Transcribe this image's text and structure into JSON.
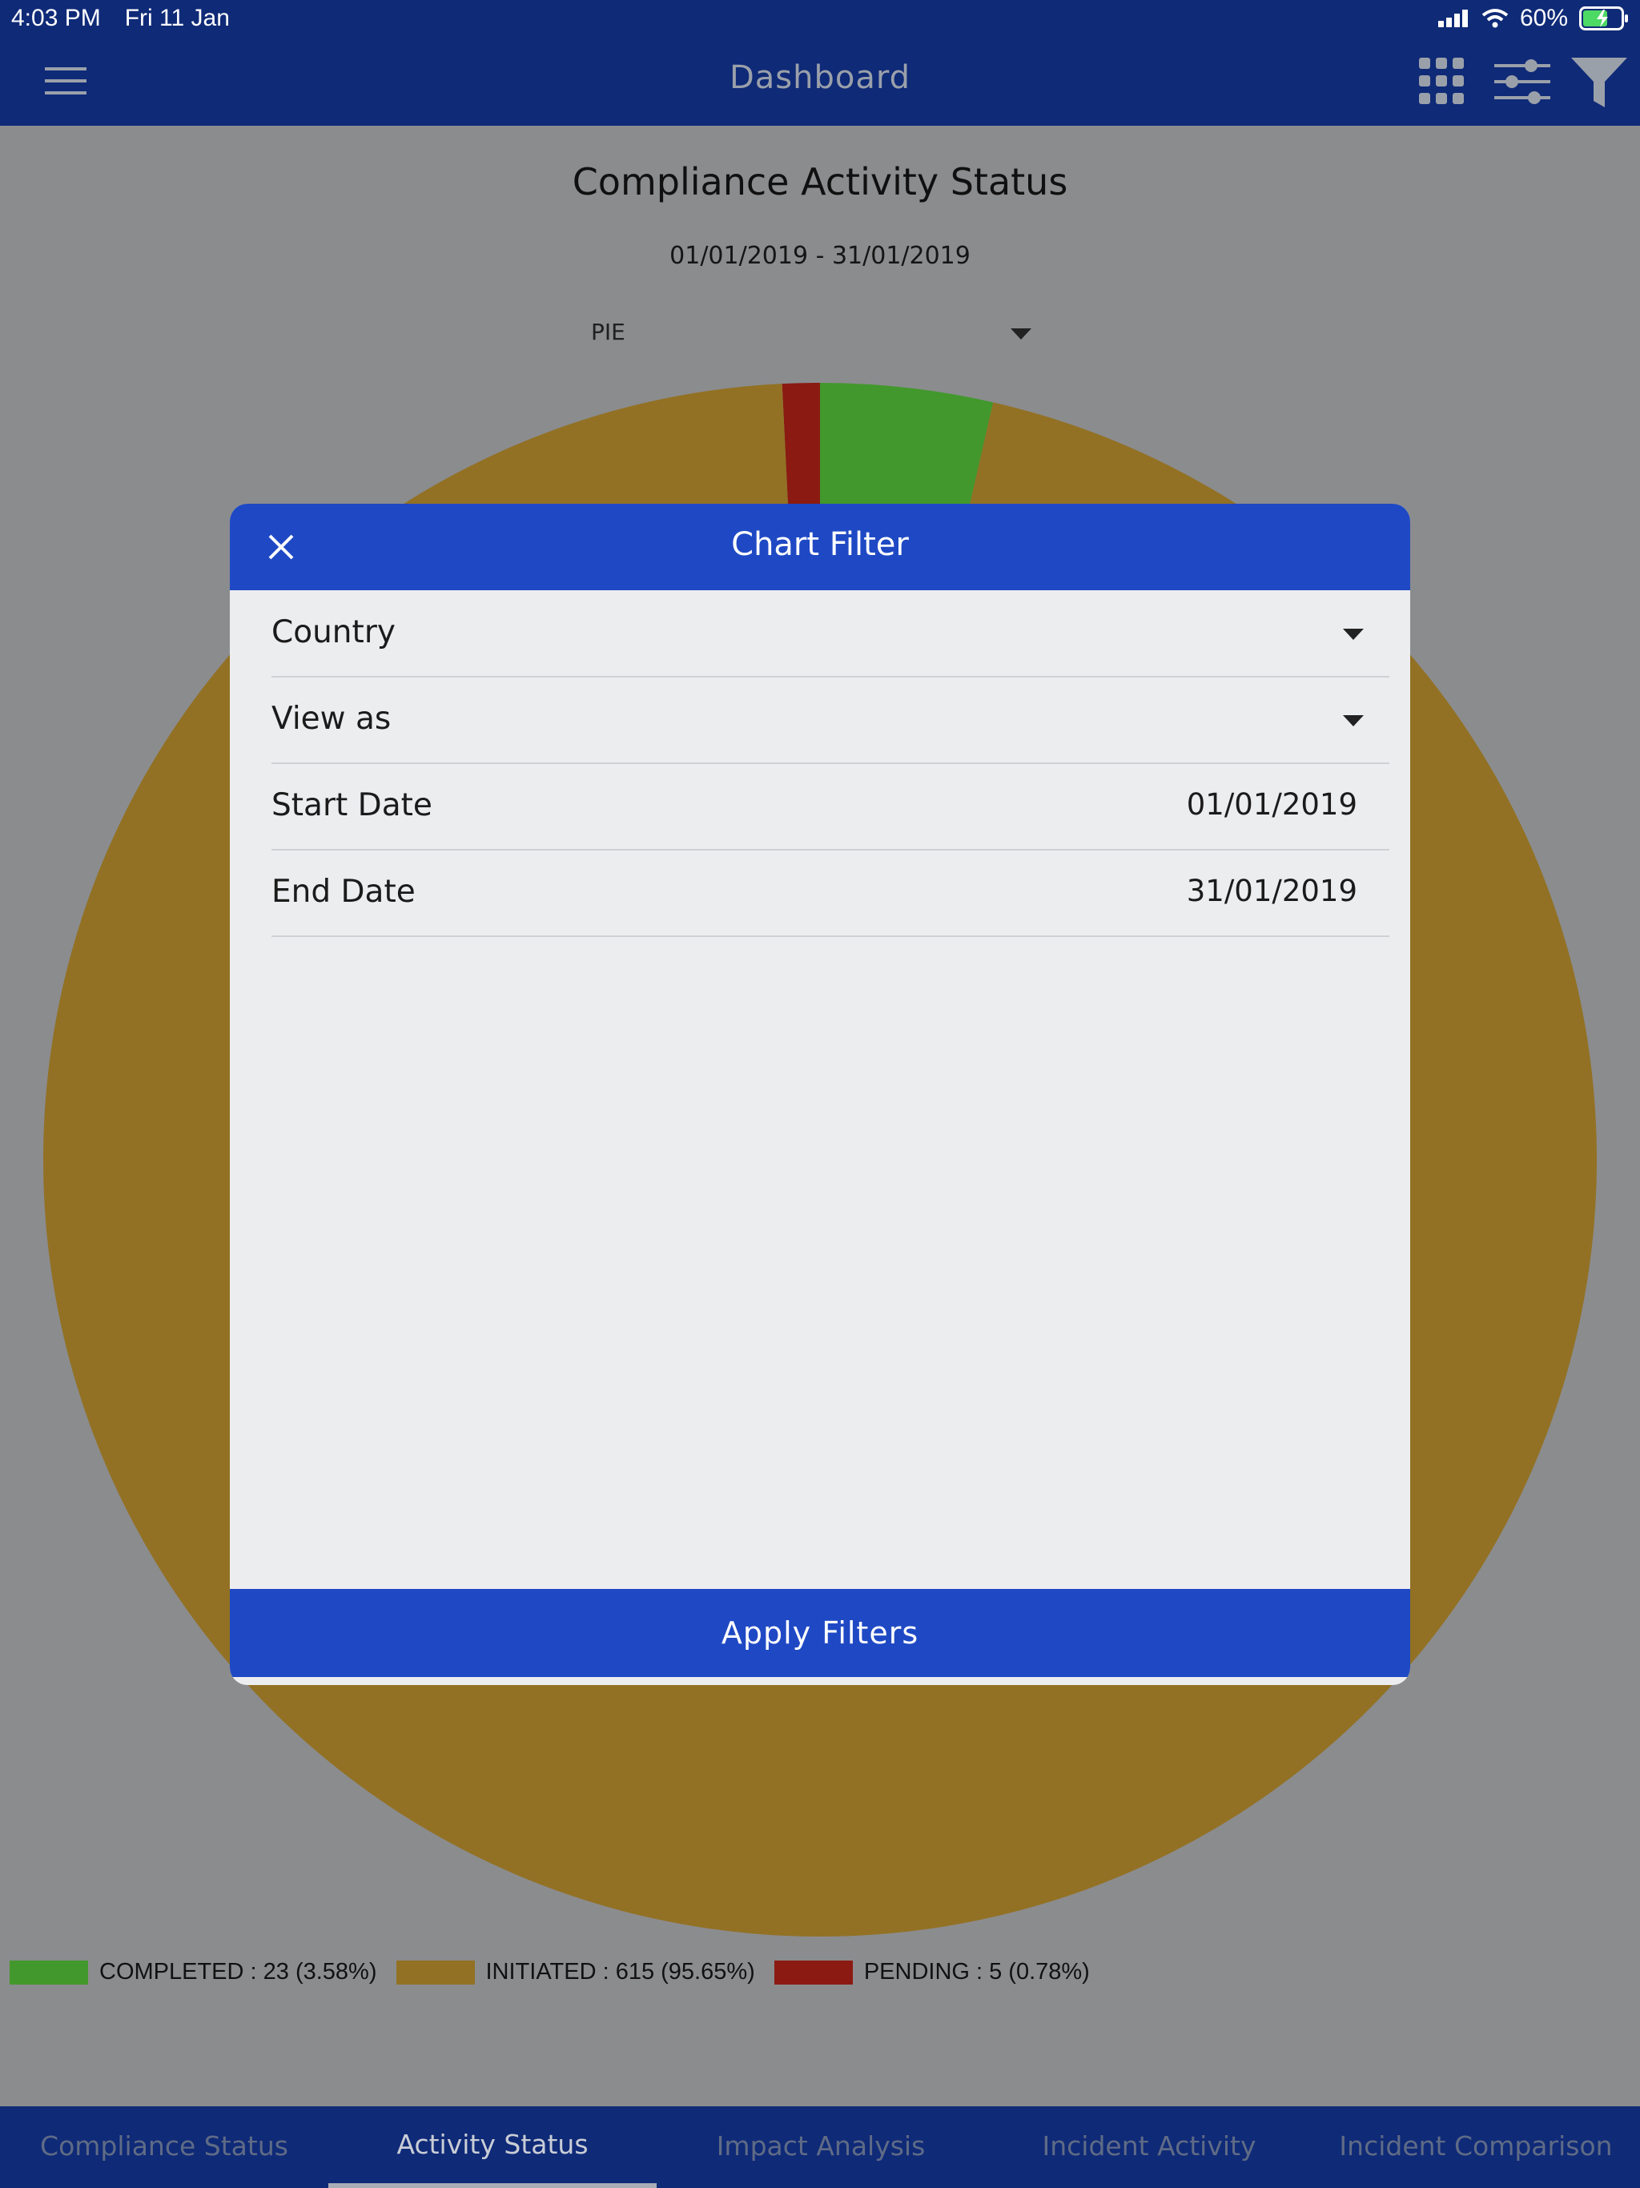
{
  "status_bar": {
    "time": "4:03 PM",
    "date": "Fri 11 Jan",
    "battery": "60%"
  },
  "nav": {
    "title": "Dashboard",
    "icons": [
      "menu-icon",
      "grid-icon",
      "sliders-icon",
      "filter-icon"
    ]
  },
  "chart_header": {
    "title": "Compliance Activity Status",
    "date_range": "01/01/2019 - 31/01/2019",
    "view_type": "PIE"
  },
  "chart_data": {
    "type": "pie",
    "title": "Compliance Activity Status",
    "categories": [
      "PENDING",
      "COMPLETED",
      "INITIATED"
    ],
    "values": [
      5,
      23,
      615
    ],
    "percentages": [
      0.78,
      3.58,
      95.65
    ],
    "colors": [
      "#8b1a12",
      "#42982c",
      "#927124"
    ],
    "legend_position": "bottom-left"
  },
  "legend": [
    {
      "label": "COMPLETED : 23 (3.58%)",
      "color": "#42982c"
    },
    {
      "label": "INITIATED : 615 (95.65%)",
      "color": "#927124"
    },
    {
      "label": "PENDING : 5 (0.78%)",
      "color": "#8b1a12"
    }
  ],
  "modal": {
    "title": "Chart Filter",
    "fields": [
      {
        "label": "Country",
        "value": ""
      },
      {
        "label": "View as",
        "value": ""
      },
      {
        "label": "Start Date",
        "value": "01/01/2019"
      },
      {
        "label": "End Date",
        "value": "31/01/2019"
      }
    ],
    "apply_label": "Apply Filters"
  },
  "tabs": [
    {
      "label": "Compliance Status"
    },
    {
      "label": "Activity Status"
    },
    {
      "label": "Impact Analysis"
    },
    {
      "label": "Incident Activity"
    },
    {
      "label": "Incident Comparison"
    }
  ],
  "colors": {
    "nav_bg": "#0f2a77",
    "modal_accent": "#1f49c4",
    "overlay_bg": "#8b8c8e"
  }
}
